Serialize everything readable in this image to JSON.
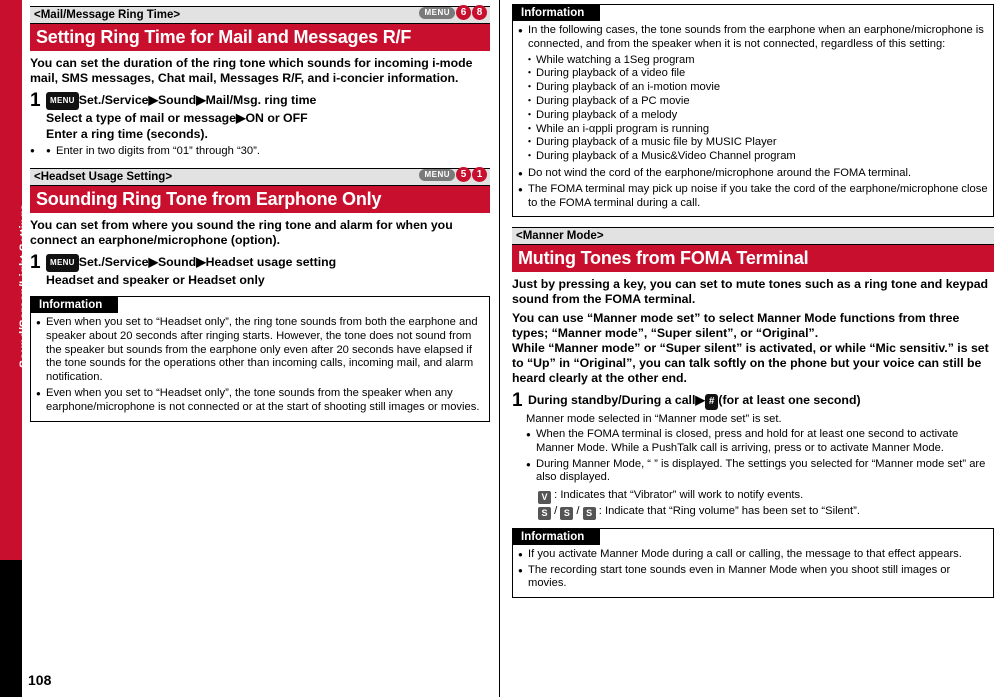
{
  "page": {
    "number": "108",
    "side_tab": "Sound/Screen/Light Settings"
  },
  "left": {
    "section1": {
      "small_title": "<Mail/Message Ring Time>",
      "title": "Setting Ring Time for Mail and Messages R/F",
      "menu_label": "MENU",
      "key1": "6",
      "key2": "8",
      "intro": "You can set the duration of the ring tone which sounds for incoming i-mode mail, SMS messages, Chat mail, Messages R/F, and i-concier information.",
      "step_num": "1",
      "step_line1_key": "MENU",
      "step_line1": "Set./Service▶Sound▶Mail/Msg. ring time",
      "step_line2": "Select a type of mail or message▶ON or OFF",
      "step_line3": "Enter a ring time (seconds).",
      "note": "Enter in two digits from “01” through “30”."
    },
    "section2": {
      "small_title": "<Headset Usage Setting>",
      "title": "Sounding Ring Tone from Earphone Only",
      "menu_label": "MENU",
      "key1": "5",
      "key2": "1",
      "intro": "You can set from where you sound the ring tone and alarm for when you connect an earphone/microphone (option).",
      "step_num": "1",
      "step_line1_key": "MENU",
      "step_line1": "Set./Service▶Sound▶Headset usage setting",
      "step_line2": "Headset and speaker or Headset only"
    },
    "information": {
      "head": "Information",
      "items": [
        "Even when you set to “Headset only”, the ring tone sounds from both the earphone and speaker about 20 seconds after ringing starts. However, the tone does not sound from the speaker but sounds from the earphone only even after 20 seconds have elapsed if the tone sounds for the operations other than incoming calls, incoming mail, and alarm notification.",
        "Even when you set to “Headset only”, the tone sounds from the speaker when any earphone/microphone is not connected or at the start of shooting still images or movies."
      ]
    }
  },
  "right": {
    "information_top": {
      "head": "Information",
      "lead": "In the following cases, the tone sounds from the earphone when an earphone/microphone is connected, and from the speaker when it is not connected, regardless of this setting:",
      "cases": [
        "While watching a 1Seg program",
        "During playback of a video file",
        "During playback of an i-motion movie",
        "During playback of a PC movie",
        "During playback of a melody",
        "While an i-αppli program is running",
        "During playback of a music file by MUSIC Player",
        "During playback of a Music&Video Channel program"
      ],
      "items": [
        "Do not wind the cord of the earphone/microphone around the FOMA terminal.",
        "The FOMA terminal may pick up noise if you take the cord of the earphone/microphone close to the FOMA terminal during a call."
      ]
    },
    "section3": {
      "small_title": "<Manner Mode>",
      "title": "Muting Tones from FOMA Terminal",
      "intro1": "Just by pressing a key, you can set to mute tones such as a ring tone and keypad sound from the FOMA terminal.",
      "intro2": "You can use “Manner mode set” to select Manner Mode functions from three types; “Manner mode”, “Super silent”, or “Original”.",
      "intro3": "While “Manner mode” or “Super silent” is activated, or while “Mic sensitiv.” is set to “Up” in “Original”, you can talk softly on the phone but your voice can still be heard clearly at the other end.",
      "step_num": "1",
      "step_text": "During standby/During a call▶",
      "step_key": "#",
      "step_tail": "(for at least one second)",
      "after_step": "Manner mode selected in “Manner mode set” is set.",
      "bullets": [
        "When the FOMA terminal is closed, press and hold    for at least one second to activate Manner Mode. While a PushTalk call is arriving, press    or    to activate Manner Mode.",
        "During Manner Mode, “   ” is displayed. The settings you selected for “Manner mode set” are also displayed."
      ],
      "icon_notes": [
        ": Indicates that “Vibrator” will work to notify events.",
        ": Indicate that “Ring volume” has been set to “Silent”."
      ]
    },
    "information_bottom": {
      "head": "Information",
      "items": [
        "If you activate Manner Mode during a call or calling, the message to that effect appears.",
        "The recording start tone sounds even in Manner Mode when you shoot still images or movies."
      ]
    }
  }
}
